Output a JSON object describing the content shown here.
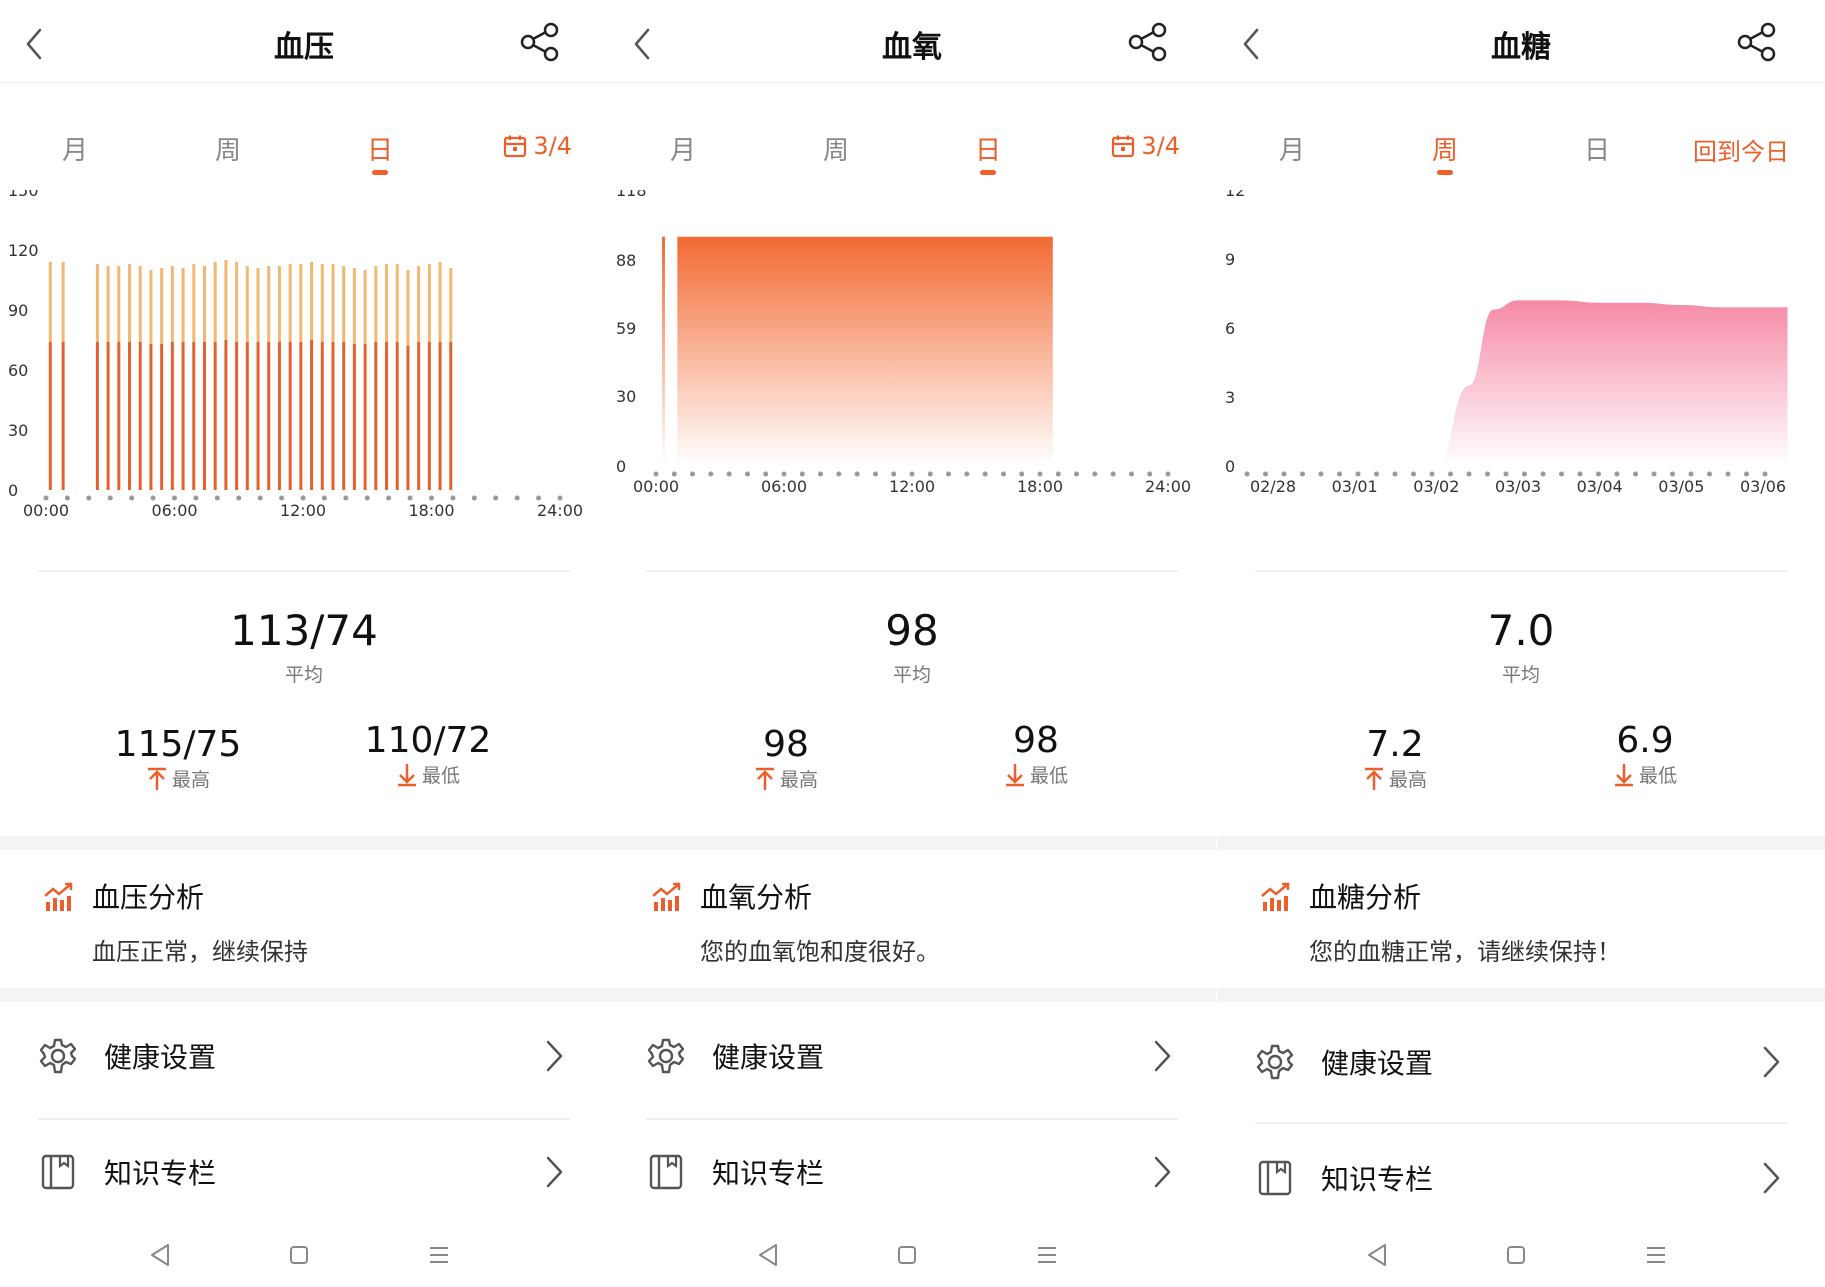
{
  "panels": [
    {
      "title": "血压",
      "tabs": [
        "月",
        "周",
        "日"
      ],
      "active_tab": 2,
      "date_label": "3/4",
      "date_icon": "calendar-icon",
      "average": {
        "value": "113/74",
        "label": "平均"
      },
      "highest": {
        "value": "115/75",
        "label": "最高"
      },
      "lowest": {
        "value": "110/72",
        "label": "最低"
      },
      "analysis": {
        "title": "血压分析",
        "text": "血压正常，继续保持"
      },
      "menu": [
        {
          "label": "健康设置",
          "icon": "gear-icon"
        },
        {
          "label": "知识专栏",
          "icon": "book-icon"
        }
      ]
    },
    {
      "title": "血氧",
      "tabs": [
        "月",
        "周",
        "日"
      ],
      "active_tab": 2,
      "date_label": "3/4",
      "date_icon": "calendar-icon",
      "average": {
        "value": "98",
        "label": "平均"
      },
      "highest": {
        "value": "98",
        "label": "最高"
      },
      "lowest": {
        "value": "98",
        "label": "最低"
      },
      "analysis": {
        "title": "血氧分析",
        "text": "您的血氧饱和度很好。"
      },
      "menu": [
        {
          "label": "健康设置",
          "icon": "gear-icon"
        },
        {
          "label": "知识专栏",
          "icon": "book-icon"
        }
      ]
    },
    {
      "title": "血糖",
      "tabs": [
        "月",
        "周",
        "日"
      ],
      "active_tab": 1,
      "date_label": "回到今日",
      "date_icon": "",
      "average": {
        "value": "7.0",
        "label": "平均"
      },
      "highest": {
        "value": "7.2",
        "label": "最高"
      },
      "lowest": {
        "value": "6.9",
        "label": "最低"
      },
      "analysis": {
        "title": "血糖分析",
        "text": "您的血糖正常，请继续保持！"
      },
      "menu": [
        {
          "label": "健康设置",
          "icon": "gear-icon"
        },
        {
          "label": "知识专栏",
          "icon": "book-icon"
        }
      ]
    }
  ],
  "colors": {
    "accent": "#ec5f2a",
    "bp_systolic": "#f2b872",
    "bp_diastolic": "#e2622e",
    "spo2": "#f26a33",
    "glucose": "#f58aa6",
    "dot": "#999999"
  },
  "nav_icons": [
    "back-triangle-icon",
    "home-square-icon",
    "menu-lines-icon"
  ],
  "chart_data": [
    {
      "type": "bar",
      "y_ticks": [
        0,
        30,
        60,
        90,
        120,
        150
      ],
      "ylim": [
        0,
        150
      ],
      "x_tick_labels": [
        "00:00",
        "06:00",
        "12:00",
        "18:00",
        "24:00"
      ],
      "xlim_hours": [
        0,
        24
      ],
      "series": [],
      "readings": [
        {
          "hour": 0.2,
          "systolic": 114,
          "diastolic": 74
        },
        {
          "hour": 0.8,
          "systolic": 114,
          "diastolic": 74
        },
        {
          "hour": 2.4,
          "systolic": 113,
          "diastolic": 74
        },
        {
          "hour": 2.9,
          "systolic": 112,
          "diastolic": 74
        },
        {
          "hour": 3.4,
          "systolic": 112,
          "diastolic": 74
        },
        {
          "hour": 3.9,
          "systolic": 113,
          "diastolic": 74
        },
        {
          "hour": 4.4,
          "systolic": 112,
          "diastolic": 74
        },
        {
          "hour": 4.9,
          "systolic": 110,
          "diastolic": 73
        },
        {
          "hour": 5.4,
          "systolic": 111,
          "diastolic": 73
        },
        {
          "hour": 5.9,
          "systolic": 112,
          "diastolic": 74
        },
        {
          "hour": 6.4,
          "systolic": 111,
          "diastolic": 74
        },
        {
          "hour": 6.9,
          "systolic": 113,
          "diastolic": 74
        },
        {
          "hour": 7.4,
          "systolic": 112,
          "diastolic": 74
        },
        {
          "hour": 7.9,
          "systolic": 114,
          "diastolic": 74
        },
        {
          "hour": 8.4,
          "systolic": 115,
          "diastolic": 75
        },
        {
          "hour": 8.9,
          "systolic": 114,
          "diastolic": 74
        },
        {
          "hour": 9.4,
          "systolic": 112,
          "diastolic": 74
        },
        {
          "hour": 9.9,
          "systolic": 111,
          "diastolic": 74
        },
        {
          "hour": 10.4,
          "systolic": 112,
          "diastolic": 74
        },
        {
          "hour": 10.9,
          "systolic": 112,
          "diastolic": 74
        },
        {
          "hour": 11.4,
          "systolic": 113,
          "diastolic": 74
        },
        {
          "hour": 11.9,
          "systolic": 113,
          "diastolic": 74
        },
        {
          "hour": 12.4,
          "systolic": 114,
          "diastolic": 75
        },
        {
          "hour": 12.9,
          "systolic": 113,
          "diastolic": 74
        },
        {
          "hour": 13.4,
          "systolic": 113,
          "diastolic": 74
        },
        {
          "hour": 13.9,
          "systolic": 112,
          "diastolic": 74
        },
        {
          "hour": 14.4,
          "systolic": 111,
          "diastolic": 73
        },
        {
          "hour": 14.9,
          "systolic": 110,
          "diastolic": 73
        },
        {
          "hour": 15.4,
          "systolic": 112,
          "diastolic": 74
        },
        {
          "hour": 15.9,
          "systolic": 113,
          "diastolic": 74
        },
        {
          "hour": 16.4,
          "systolic": 113,
          "diastolic": 74
        },
        {
          "hour": 16.9,
          "systolic": 110,
          "diastolic": 72
        },
        {
          "hour": 17.4,
          "systolic": 112,
          "diastolic": 74
        },
        {
          "hour": 17.9,
          "systolic": 113,
          "diastolic": 74
        },
        {
          "hour": 18.4,
          "systolic": 114,
          "diastolic": 74
        },
        {
          "hour": 18.9,
          "systolic": 111,
          "diastolic": 74
        }
      ],
      "grid": false
    },
    {
      "type": "area",
      "y_ticks": [
        0,
        30,
        59,
        88,
        118
      ],
      "ylim": [
        0,
        118
      ],
      "x_tick_labels": [
        "00:00",
        "06:00",
        "12:00",
        "18:00",
        "24:00"
      ],
      "xlim_hours": [
        0,
        24
      ],
      "series": [],
      "single_reading": {
        "hour": 0.35,
        "value": 98
      },
      "block": {
        "start_hour": 1.0,
        "end_hour": 18.6,
        "value": 98
      },
      "grid": false
    },
    {
      "type": "area",
      "y_ticks": [
        0,
        3,
        6,
        9,
        12
      ],
      "ylim": [
        0,
        12
      ],
      "x_tick_labels": [
        "02/28",
        "03/01",
        "03/02",
        "03/03",
        "03/04",
        "03/05",
        "03/06"
      ],
      "x": [
        2.0,
        2.4,
        2.7,
        3.0,
        3.5,
        4.0,
        4.5,
        5.0,
        5.5,
        6.0,
        6.3
      ],
      "values": [
        0,
        3.5,
        6.8,
        7.2,
        7.2,
        7.1,
        7.1,
        7.0,
        6.9,
        6.9,
        6.9
      ],
      "series": [],
      "grid": false
    }
  ]
}
